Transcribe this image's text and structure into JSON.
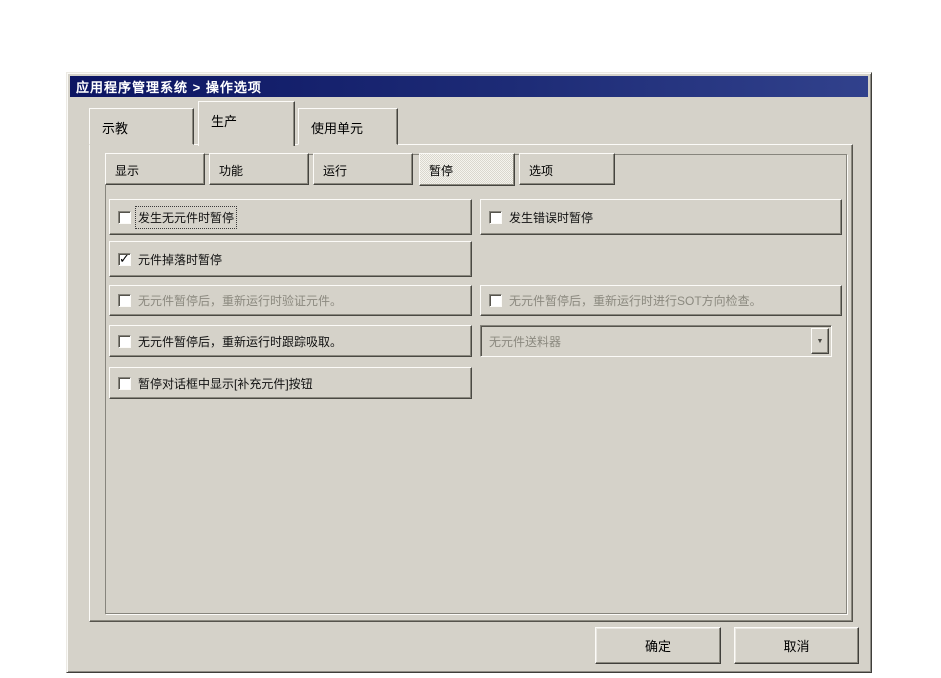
{
  "window": {
    "title": "应用程序管理系统 > 操作选项"
  },
  "colors": {
    "window_bg": "#d5d2c9",
    "titlebar_gradient_left": "#0c1562",
    "titlebar_gradient_right": "#31418c",
    "titlebar_text": "#ffffff",
    "disabled_text": "#8b897f",
    "selected_inner_tab_bg": "#ecebe3"
  },
  "outer_tabs": [
    {
      "label": "示教",
      "selected": false
    },
    {
      "label": "生产",
      "selected": true
    },
    {
      "label": "使用单元",
      "selected": false
    }
  ],
  "inner_tabs": [
    {
      "label": "显示",
      "selected": false
    },
    {
      "label": "功能",
      "selected": false
    },
    {
      "label": "运行",
      "selected": false
    },
    {
      "label": "暂停",
      "selected": true
    },
    {
      "label": "选项",
      "selected": false
    }
  ],
  "options": {
    "left": [
      {
        "label": "发生无元件时暂停",
        "checked": false,
        "disabled": false,
        "focused": true
      },
      {
        "label": "元件掉落时暂停",
        "checked": true,
        "disabled": false,
        "focused": false
      },
      {
        "label": "无元件暂停后，重新运行时验证元件。",
        "checked": false,
        "disabled": true,
        "focused": false
      },
      {
        "label": "无元件暂停后，重新运行时跟踪吸取。",
        "checked": false,
        "disabled": false,
        "focused": false
      },
      {
        "label": "暂停对话框中显示[补充元件]按钮",
        "checked": false,
        "disabled": false,
        "focused": false
      }
    ],
    "right": [
      {
        "label": "发生错误时暂停",
        "checked": false,
        "disabled": false,
        "focused": false
      },
      {
        "label": "无元件暂停后，重新运行时进行SOT方向检查。",
        "checked": false,
        "disabled": true,
        "focused": false
      }
    ]
  },
  "feeder_combo": {
    "value": "无元件送料器",
    "disabled": true
  },
  "icons": {
    "checkmark": "✓",
    "dropdown_arrow": "▼"
  },
  "footer": {
    "ok_label": "确定",
    "cancel_label": "取消"
  }
}
